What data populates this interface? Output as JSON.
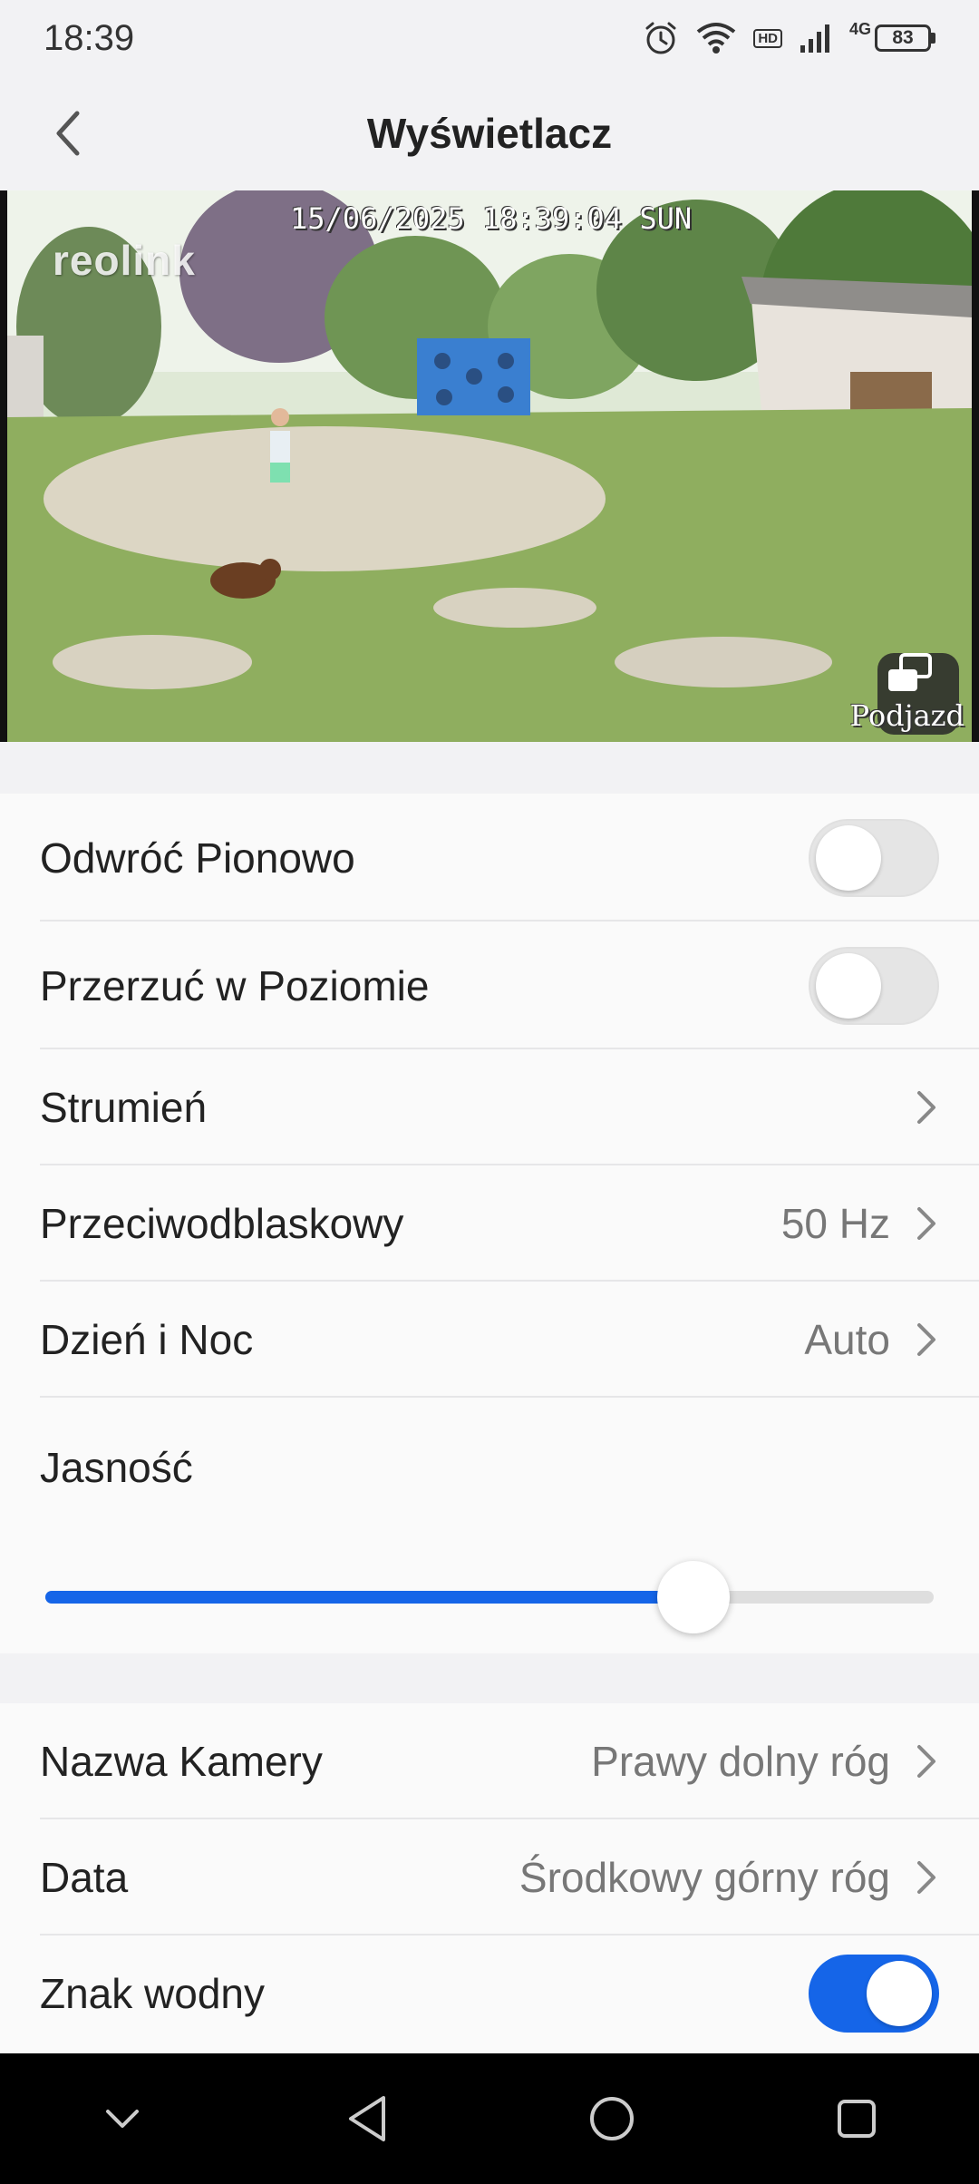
{
  "status_bar": {
    "time": "18:39",
    "network": "4G",
    "hd": "HD",
    "battery": "83"
  },
  "header": {
    "title": "Wyświetlacz",
    "back_icon": "chevron-left-icon"
  },
  "preview": {
    "osd_datetime": "15/06/2025 18:39:04 SUN",
    "osd_logo": "reolink",
    "osd_camera_name": "Podjazd",
    "pip_icon": "picture-in-picture-icon"
  },
  "settings": {
    "flip_vertical": {
      "label": "Odwróć Pionowo",
      "on": false
    },
    "mirror_horizontal": {
      "label": "Przerzuć w Poziomie",
      "on": false
    },
    "stream": {
      "label": "Strumień"
    },
    "anti_flicker": {
      "label": "Przeciwodblaskowy",
      "value": "50 Hz"
    },
    "day_night": {
      "label": "Dzień i Noc",
      "value": "Auto"
    },
    "brightness": {
      "label": "Jasność",
      "level_fraction": 0.73
    },
    "camera_name": {
      "label": "Nazwa Kamery",
      "value": "Prawy dolny róg"
    },
    "date": {
      "label": "Data",
      "value": "Środkowy górny róg"
    },
    "watermark": {
      "label": "Znak wodny",
      "on": true
    }
  },
  "colors": {
    "accent": "#1565e8",
    "background": "#f2f2f4",
    "card": "#fafafa"
  },
  "navbar": {
    "icons": [
      "chevron-down-icon",
      "back-triangle-icon",
      "home-circle-icon",
      "recents-square-icon"
    ]
  }
}
